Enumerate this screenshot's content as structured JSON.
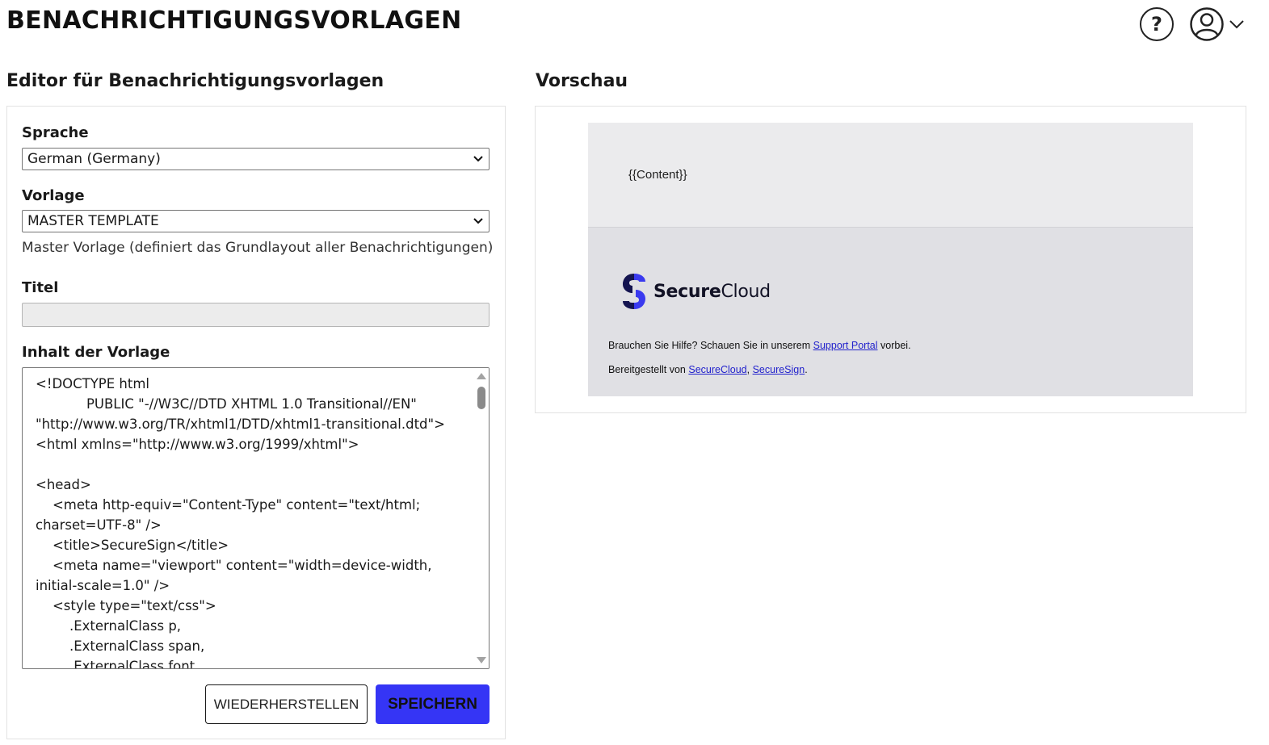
{
  "header": {
    "title": "BENACHRICHTIGUNGSVORLAGEN",
    "help_glyph": "?",
    "icons": [
      "help-icon",
      "user-icon",
      "chevron-down-icon"
    ]
  },
  "editor": {
    "section_title": "Editor für Benachrichtigungsvorlagen",
    "language_label": "Sprache",
    "language_value": "German (Germany)",
    "template_label": "Vorlage",
    "template_value": "MASTER TEMPLATE",
    "template_description": "Master Vorlage (definiert das Grundlayout aller Benachrichtigungen)",
    "title_label": "Titel",
    "title_value": "",
    "content_label": "Inhalt der Vorlage",
    "content_value": "<!DOCTYPE html\n\t\t\tPUBLIC \"-//W3C//DTD XHTML 1.0 Transitional//EN\"\n\"http://www.w3.org/TR/xhtml1/DTD/xhtml1-transitional.dtd\">\n<html xmlns=\"http://www.w3.org/1999/xhtml\">\n\n<head>\n\t<meta http-equiv=\"Content-Type\" content=\"text/html;\ncharset=UTF-8\" />\n\t<title>SecureSign</title>\n\t<meta name=\"viewport\" content=\"width=device-width,\ninitial-scale=1.0\" />\n\t<style type=\"text/css\">\n\t\t.ExternalClass p,\n\t\t.ExternalClass span,\n\t\t.ExternalClass font,",
    "restore_label": "WIEDERHERSTELLEN",
    "save_label": "SPEICHERN"
  },
  "preview": {
    "section_title": "Vorschau",
    "content_placeholder": "{{Content}}",
    "logo_bold": "Secure",
    "logo_regular": "Cloud",
    "help_prefix": "Brauchen Sie Hilfe? Schauen Sie in unserem ",
    "help_link": "Support Portal",
    "help_suffix": " vorbei.",
    "provided_prefix": "Bereitgestellt von ",
    "provided_link1": "SecureCloud",
    "provided_sep": ", ",
    "provided_link2": "SecureSign",
    "provided_suffix": "."
  },
  "colors": {
    "primary_button": "#3535f5",
    "logo_blue": "#3a3aef",
    "logo_navy": "#141450",
    "link": "#2222cc"
  }
}
